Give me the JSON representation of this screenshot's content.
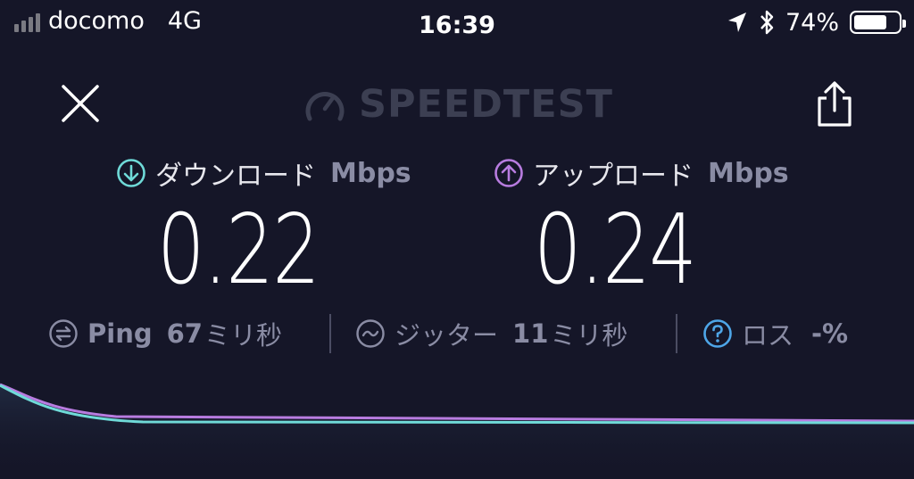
{
  "status_bar": {
    "carrier": "docomo",
    "network": "4G",
    "time": "16:39",
    "battery_percent": "74%",
    "battery_level": 0.74,
    "icons": [
      "signal-bars-icon",
      "location-arrow-icon",
      "bluetooth-icon",
      "battery-icon"
    ]
  },
  "header": {
    "brand": "SPEEDTEST",
    "close_icon": "close-icon",
    "share_icon": "share-icon"
  },
  "download": {
    "label": "ダウンロード",
    "unit": "Mbps",
    "value": "0.22",
    "icon": "download-arrow-icon",
    "color": "#6fdad8"
  },
  "upload": {
    "label": "アップロード",
    "unit": "Mbps",
    "value": "0.24",
    "icon": "upload-arrow-icon",
    "color": "#b87ce0"
  },
  "stats": {
    "ping": {
      "label": "Ping",
      "value": "67",
      "unit": "ミリ秒",
      "icon": "ping-icon"
    },
    "jitter": {
      "label": "ジッター",
      "value": "11",
      "unit": "ミリ秒",
      "icon": "jitter-icon"
    },
    "loss": {
      "label": "ロス",
      "value": "-%",
      "icon": "help-icon",
      "color": "#4ea6e8"
    }
  }
}
